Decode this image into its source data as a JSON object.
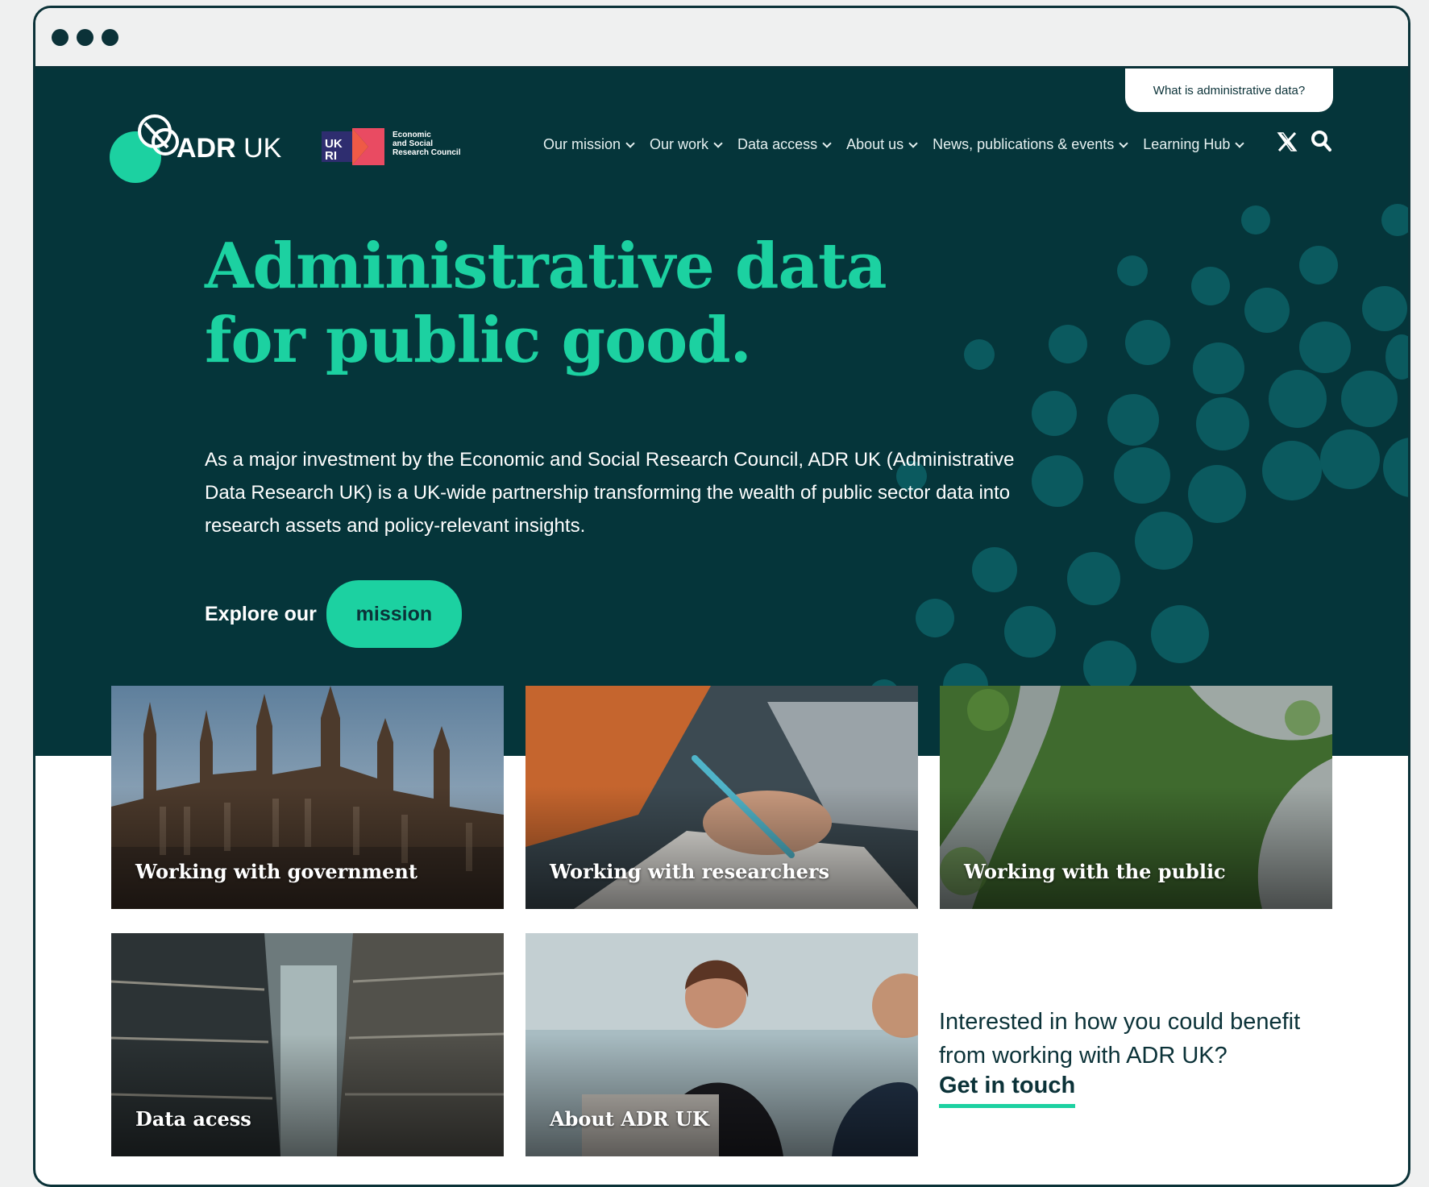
{
  "window": {
    "controls": [
      "close",
      "minimize",
      "maximize"
    ]
  },
  "header": {
    "utility_link": "What is administrative data?",
    "logo": {
      "text_bold": "ADR",
      "text_regular": " UK"
    },
    "partner": {
      "badge": "UK RI",
      "line1": "Economic",
      "line2": "and Social",
      "line3": "Research Council"
    },
    "nav": [
      {
        "label": "Our mission"
      },
      {
        "label": "Our work"
      },
      {
        "label": "Data access"
      },
      {
        "label": "About us"
      },
      {
        "label": "News, publications & events"
      },
      {
        "label": "Learning Hub"
      }
    ],
    "icons": [
      "x-social-icon",
      "search-icon"
    ]
  },
  "hero": {
    "title_line1": "Administrative data",
    "title_line2": "for public good.",
    "description": "As a major investment by the Economic and Social Research Council, ADR UK (Administrative Data Research UK) is a UK-wide partnership transforming the wealth of public sector data into research assets and policy-relevant insights.",
    "explore_label": "Explore our",
    "mission_button": "mission"
  },
  "cards": [
    {
      "label": "Working with government"
    },
    {
      "label": "Working with researchers"
    },
    {
      "label": "Working with the public"
    },
    {
      "label": "Data acess"
    },
    {
      "label": "About ADR UK"
    }
  ],
  "cta": {
    "text": "Interested in how you could benefit from working with ADR UK?",
    "link": "Get in touch"
  },
  "colors": {
    "brand_dark": "#05353a",
    "accent": "#1cd1a1",
    "bubble": "#0b5a5f",
    "white": "#ffffff"
  }
}
